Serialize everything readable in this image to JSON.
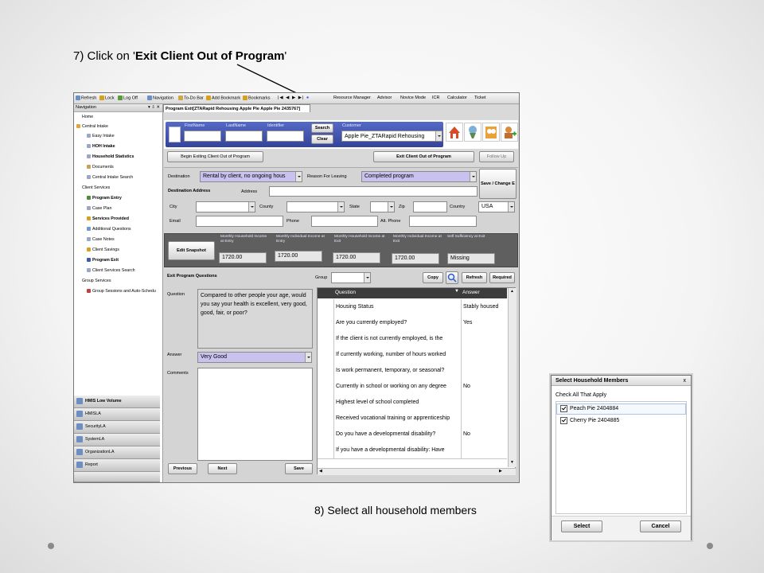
{
  "slide": {
    "step7_prefix": "7) Click on '",
    "step7_bold": "Exit Client Out of Program",
    "step7_suffix": "'",
    "step8_caption": "8) Select all household members"
  },
  "toolbar": {
    "items": [
      "Refresh",
      "Lock",
      "Log Off",
      "Navigation",
      "To-Do Bar",
      "Add Bookmark",
      "Bookmarks",
      "Resource Manager",
      "Advisor",
      "Novice Mode",
      "ICR",
      "Calculator",
      "Ticket"
    ]
  },
  "nav": {
    "title": "Navigation",
    "pin_glyphs": "▾ ⇩ ✕",
    "tree": [
      {
        "label": "Home",
        "bold": false
      },
      {
        "label": "Central Intake",
        "bold": false
      },
      {
        "label": "Easy Intake",
        "bold": false
      },
      {
        "label": "HOH Intake",
        "bold": true
      },
      {
        "label": "Household Statistics",
        "bold": true
      },
      {
        "label": "Documents",
        "bold": false
      },
      {
        "label": "Central Intake Search",
        "bold": false
      },
      {
        "label": "Client Services",
        "bold": false
      },
      {
        "label": "Program Entry",
        "bold": true
      },
      {
        "label": "Case Plan",
        "bold": false
      },
      {
        "label": "Services Provided",
        "bold": true
      },
      {
        "label": "Additional Questions",
        "bold": false
      },
      {
        "label": "Case Notes",
        "bold": false
      },
      {
        "label": "Client Savings",
        "bold": false
      },
      {
        "label": "Program Exit",
        "bold": true
      },
      {
        "label": "Client Services Search",
        "bold": false
      },
      {
        "label": "Group Services",
        "bold": false
      },
      {
        "label": "Group Sessions and Auto-Schedu",
        "bold": false
      }
    ],
    "accordion": [
      "HMIS Low Volume",
      "HMISLA",
      "SecurityLA",
      "SystemLA",
      "OrganizationLA",
      "Report"
    ]
  },
  "main": {
    "tab_title": "Program Exit[ZTARapid Rehousing Apple Pie Apple Pie 2435767]",
    "header": {
      "firstname_label": "FirstName",
      "lastname_label": "LastName",
      "identifier_label": "Identifier",
      "customer_label": "Customer",
      "customer_value": "Apple  Pie_ZTARapid Rehousing",
      "search_btn": "Search",
      "clear_btn": "Clear"
    },
    "actions": {
      "begin_exit": "Begin Exiting Client Out of Program",
      "exit_client": "Exit Client Out of Program",
      "follow_up": "Follow Up"
    },
    "destination": {
      "destination_label": "Destination",
      "destination_value": "Rental by client, no ongoing hous",
      "reason_label": "Reason For Leaving",
      "reason_value": "Completed program",
      "save_change": "Save / Change E",
      "dest_address_label": "Destination Address",
      "address_label": "Address",
      "city_label": "City",
      "county_label": "County",
      "state_label": "State",
      "zip_label": "Zip",
      "country_label": "Country",
      "country_value": "USA",
      "email_label": "Email",
      "phone_label": "Phone",
      "alt_phone_label": "Alt. Phone"
    },
    "snapshot": {
      "edit_btn": "Edit Snapshot",
      "cols": [
        {
          "label": "Monthly  Household Income at Entry",
          "value": "1720.00"
        },
        {
          "label": "Monthly Individual Income at Entry",
          "value": "1720.00"
        },
        {
          "label": "Monthly  Household Income at Exit",
          "value": "1720.00"
        },
        {
          "label": "Monthly Individual Income at Exit",
          "value": "1720.00"
        },
        {
          "label": "Self Sufficiency at Exit",
          "value": "Missing"
        }
      ]
    },
    "questions": {
      "title": "Exit Program Questions",
      "group_label": "Group",
      "copy_btn": "Copy",
      "refresh_btn": "Refresh",
      "required_btn": "Required",
      "question_label": "Question",
      "question_text": "Compared to other people your age, would you say your health is excellent, very good, good, fair, or poor?",
      "answer_label": "Answer",
      "answer_value": "Very Good",
      "comments_label": "Comments",
      "previous_btn": "Previous",
      "next_btn": "Next",
      "save_btn": "Save",
      "grid_headers": {
        "question": "Question",
        "answer": "Answer"
      },
      "rows": [
        {
          "q": "Housing Status",
          "a": "Stably housed"
        },
        {
          "q": "Are you currently employed?",
          "a": "Yes"
        },
        {
          "q": "If the client is not currently employed, is the",
          "a": ""
        },
        {
          "q": "If currently working, number of hours worked",
          "a": ""
        },
        {
          "q": "Is work permanent, temporary, or seasonal?",
          "a": ""
        },
        {
          "q": "Currently in school or working on any degree",
          "a": "No"
        },
        {
          "q": "Highest level of school completed",
          "a": ""
        },
        {
          "q": "Received vocational training or apprenticeship",
          "a": ""
        },
        {
          "q": "Do you have a developmental disability?",
          "a": "No"
        },
        {
          "q": "If you have a developmental disability: Have",
          "a": ""
        }
      ]
    }
  },
  "dialog": {
    "title": "Select Household Members",
    "close": "x",
    "check_all": "Check All That Apply",
    "members": [
      {
        "label": "Peach Pie 2404884",
        "checked": true
      },
      {
        "label": "Cherry Pie 2404885",
        "checked": true
      }
    ],
    "select_btn": "Select",
    "cancel_btn": "Cancel"
  },
  "colors": {
    "accent_purple": "#c9c2ee",
    "header_bg": "#3b4db0",
    "dark_panel": "#5f5f5f"
  }
}
